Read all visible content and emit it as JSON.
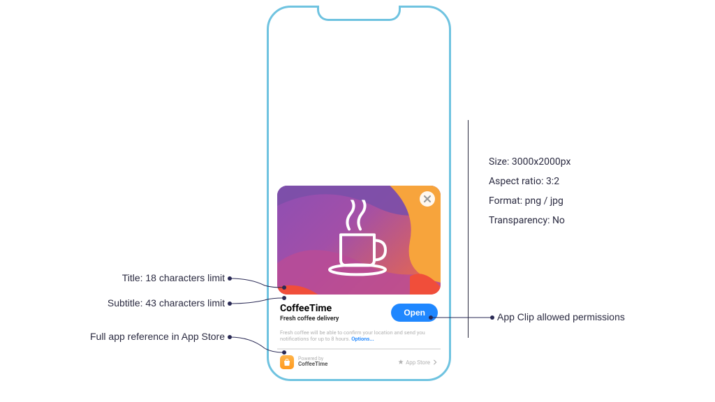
{
  "appclip": {
    "title": "CoffeeTime",
    "subtitle": "Fresh coffee delivery",
    "open_label": "Open",
    "permissions_text": "Fresh coffee will be able to confirm your location and send you notifications for up to 8 hours.",
    "permissions_options": "Options...",
    "footer_powered": "Powered by",
    "footer_app": "CoffeeTime",
    "store_label": "App Store"
  },
  "annotations": {
    "title_limit": "Title: 18 characters limit",
    "subtitle_limit": "Subtitle: 43 characters limit",
    "appstore_ref": "Full app reference in App Store",
    "permissions": "App Clip allowed permissions"
  },
  "specs": {
    "size": "Size: 3000x2000px",
    "aspect": "Aspect ratio: 3:2",
    "format": "Format: png / jpg",
    "transparency": "Transparency: No"
  }
}
